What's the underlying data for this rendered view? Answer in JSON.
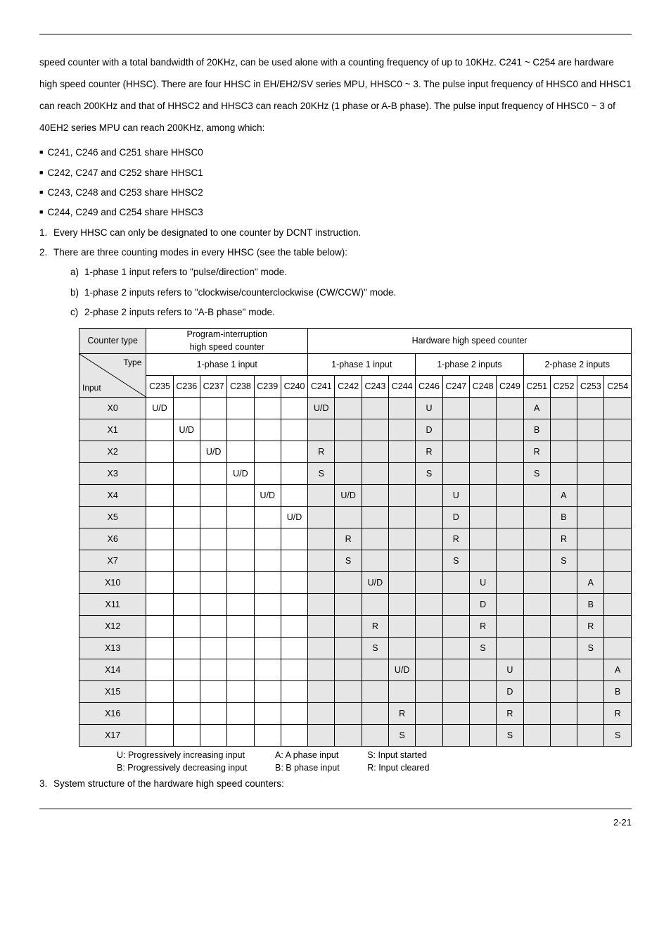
{
  "para1": "speed counter with a total bandwidth of 20KHz, can be used alone with a counting frequency of up to 10KHz. C241 ~ C254 are hardware high speed counter (HHSC). There are four HHSC in EH/EH2/SV series MPU, HHSC0 ~ 3. The pulse input frequency of HHSC0 and HHSC1 can reach 200KHz and that of HHSC2 and HHSC3 can reach 20KHz (1 phase or A-B phase). The pulse input frequency of HHSC0 ~ 3 of 40EH2 series MPU can reach 200KHz, among which:",
  "bullets": [
    "C241, C246 and C251 share HHSC0",
    "C242, C247 and C252 share HHSC1",
    "C243, C248 and C253 share HHSC2",
    "C244, C249 and C254 share HHSC3"
  ],
  "num1": "Every HHSC can only be designated to one counter by DCNT instruction.",
  "num2": "There are three counting modes in every HHSC (see the table below):",
  "sub": [
    "1-phase 1 input refers to \"pulse/direction\" mode.",
    "1-phase 2 inputs refers to \"clockwise/counterclockwise (CW/CCW)\" mode.",
    "2-phase 2 inputs refers to \"A-B phase\" mode."
  ],
  "table": {
    "counter_type": "Counter type",
    "group_prog": "Program-interruption\nhigh speed counter",
    "group_hw": "Hardware high speed counter",
    "g1": "1-phase 1 input",
    "g2": "1-phase 1 input",
    "g3": "1-phase 2 inputs",
    "g4": "2-phase 2 inputs",
    "diag_type": "Type",
    "diag_input": "Input",
    "cols": [
      "C235",
      "C236",
      "C237",
      "C238",
      "C239",
      "C240",
      "C241",
      "C242",
      "C243",
      "C244",
      "C246",
      "C247",
      "C248",
      "C249",
      "C251",
      "C252",
      "C253",
      "C254"
    ],
    "rows": [
      {
        "label": "X0",
        "cells": [
          "U/D",
          "",
          "",
          "",
          "",
          "",
          "U/D",
          "",
          "",
          "",
          "U",
          "",
          "",
          "",
          "A",
          "",
          "",
          ""
        ]
      },
      {
        "label": "X1",
        "cells": [
          "",
          "U/D",
          "",
          "",
          "",
          "",
          "",
          "",
          "",
          "",
          "D",
          "",
          "",
          "",
          "B",
          "",
          "",
          ""
        ]
      },
      {
        "label": "X2",
        "cells": [
          "",
          "",
          "U/D",
          "",
          "",
          "",
          "R",
          "",
          "",
          "",
          "R",
          "",
          "",
          "",
          "R",
          "",
          "",
          ""
        ]
      },
      {
        "label": "X3",
        "cells": [
          "",
          "",
          "",
          "U/D",
          "",
          "",
          "S",
          "",
          "",
          "",
          "S",
          "",
          "",
          "",
          "S",
          "",
          "",
          ""
        ]
      },
      {
        "label": "X4",
        "cells": [
          "",
          "",
          "",
          "",
          "U/D",
          "",
          "",
          "U/D",
          "",
          "",
          "",
          "U",
          "",
          "",
          "",
          "A",
          "",
          ""
        ]
      },
      {
        "label": "X5",
        "cells": [
          "",
          "",
          "",
          "",
          "",
          "U/D",
          "",
          "",
          "",
          "",
          "",
          "D",
          "",
          "",
          "",
          "B",
          "",
          ""
        ]
      },
      {
        "label": "X6",
        "cells": [
          "",
          "",
          "",
          "",
          "",
          "",
          "",
          "R",
          "",
          "",
          "",
          "R",
          "",
          "",
          "",
          "R",
          "",
          ""
        ]
      },
      {
        "label": "X7",
        "cells": [
          "",
          "",
          "",
          "",
          "",
          "",
          "",
          "S",
          "",
          "",
          "",
          "S",
          "",
          "",
          "",
          "S",
          "",
          ""
        ]
      },
      {
        "label": "X10",
        "cells": [
          "",
          "",
          "",
          "",
          "",
          "",
          "",
          "",
          "U/D",
          "",
          "",
          "",
          "U",
          "",
          "",
          "",
          "A",
          ""
        ]
      },
      {
        "label": "X11",
        "cells": [
          "",
          "",
          "",
          "",
          "",
          "",
          "",
          "",
          "",
          "",
          "",
          "",
          "D",
          "",
          "",
          "",
          "B",
          ""
        ]
      },
      {
        "label": "X12",
        "cells": [
          "",
          "",
          "",
          "",
          "",
          "",
          "",
          "",
          "R",
          "",
          "",
          "",
          "R",
          "",
          "",
          "",
          "R",
          ""
        ]
      },
      {
        "label": "X13",
        "cells": [
          "",
          "",
          "",
          "",
          "",
          "",
          "",
          "",
          "S",
          "",
          "",
          "",
          "S",
          "",
          "",
          "",
          "S",
          ""
        ]
      },
      {
        "label": "X14",
        "cells": [
          "",
          "",
          "",
          "",
          "",
          "",
          "",
          "",
          "",
          "U/D",
          "",
          "",
          "",
          "U",
          "",
          "",
          "",
          "A"
        ]
      },
      {
        "label": "X15",
        "cells": [
          "",
          "",
          "",
          "",
          "",
          "",
          "",
          "",
          "",
          "",
          "",
          "",
          "",
          "D",
          "",
          "",
          "",
          "B"
        ]
      },
      {
        "label": "X16",
        "cells": [
          "",
          "",
          "",
          "",
          "",
          "",
          "",
          "",
          "",
          "R",
          "",
          "",
          "",
          "R",
          "",
          "",
          "",
          "R"
        ]
      },
      {
        "label": "X17",
        "cells": [
          "",
          "",
          "",
          "",
          "",
          "",
          "",
          "",
          "",
          "S",
          "",
          "",
          "",
          "S",
          "",
          "",
          "",
          "S"
        ]
      }
    ]
  },
  "legend": {
    "u": "U: Progressively increasing input",
    "b": "B: Progressively decreasing input",
    "a": "A: A phase input",
    "bb": "B: B phase input",
    "s": "S: Input started",
    "r": "R: Input cleared"
  },
  "num3": "System structure of the hardware high speed counters:",
  "page": "2-21"
}
